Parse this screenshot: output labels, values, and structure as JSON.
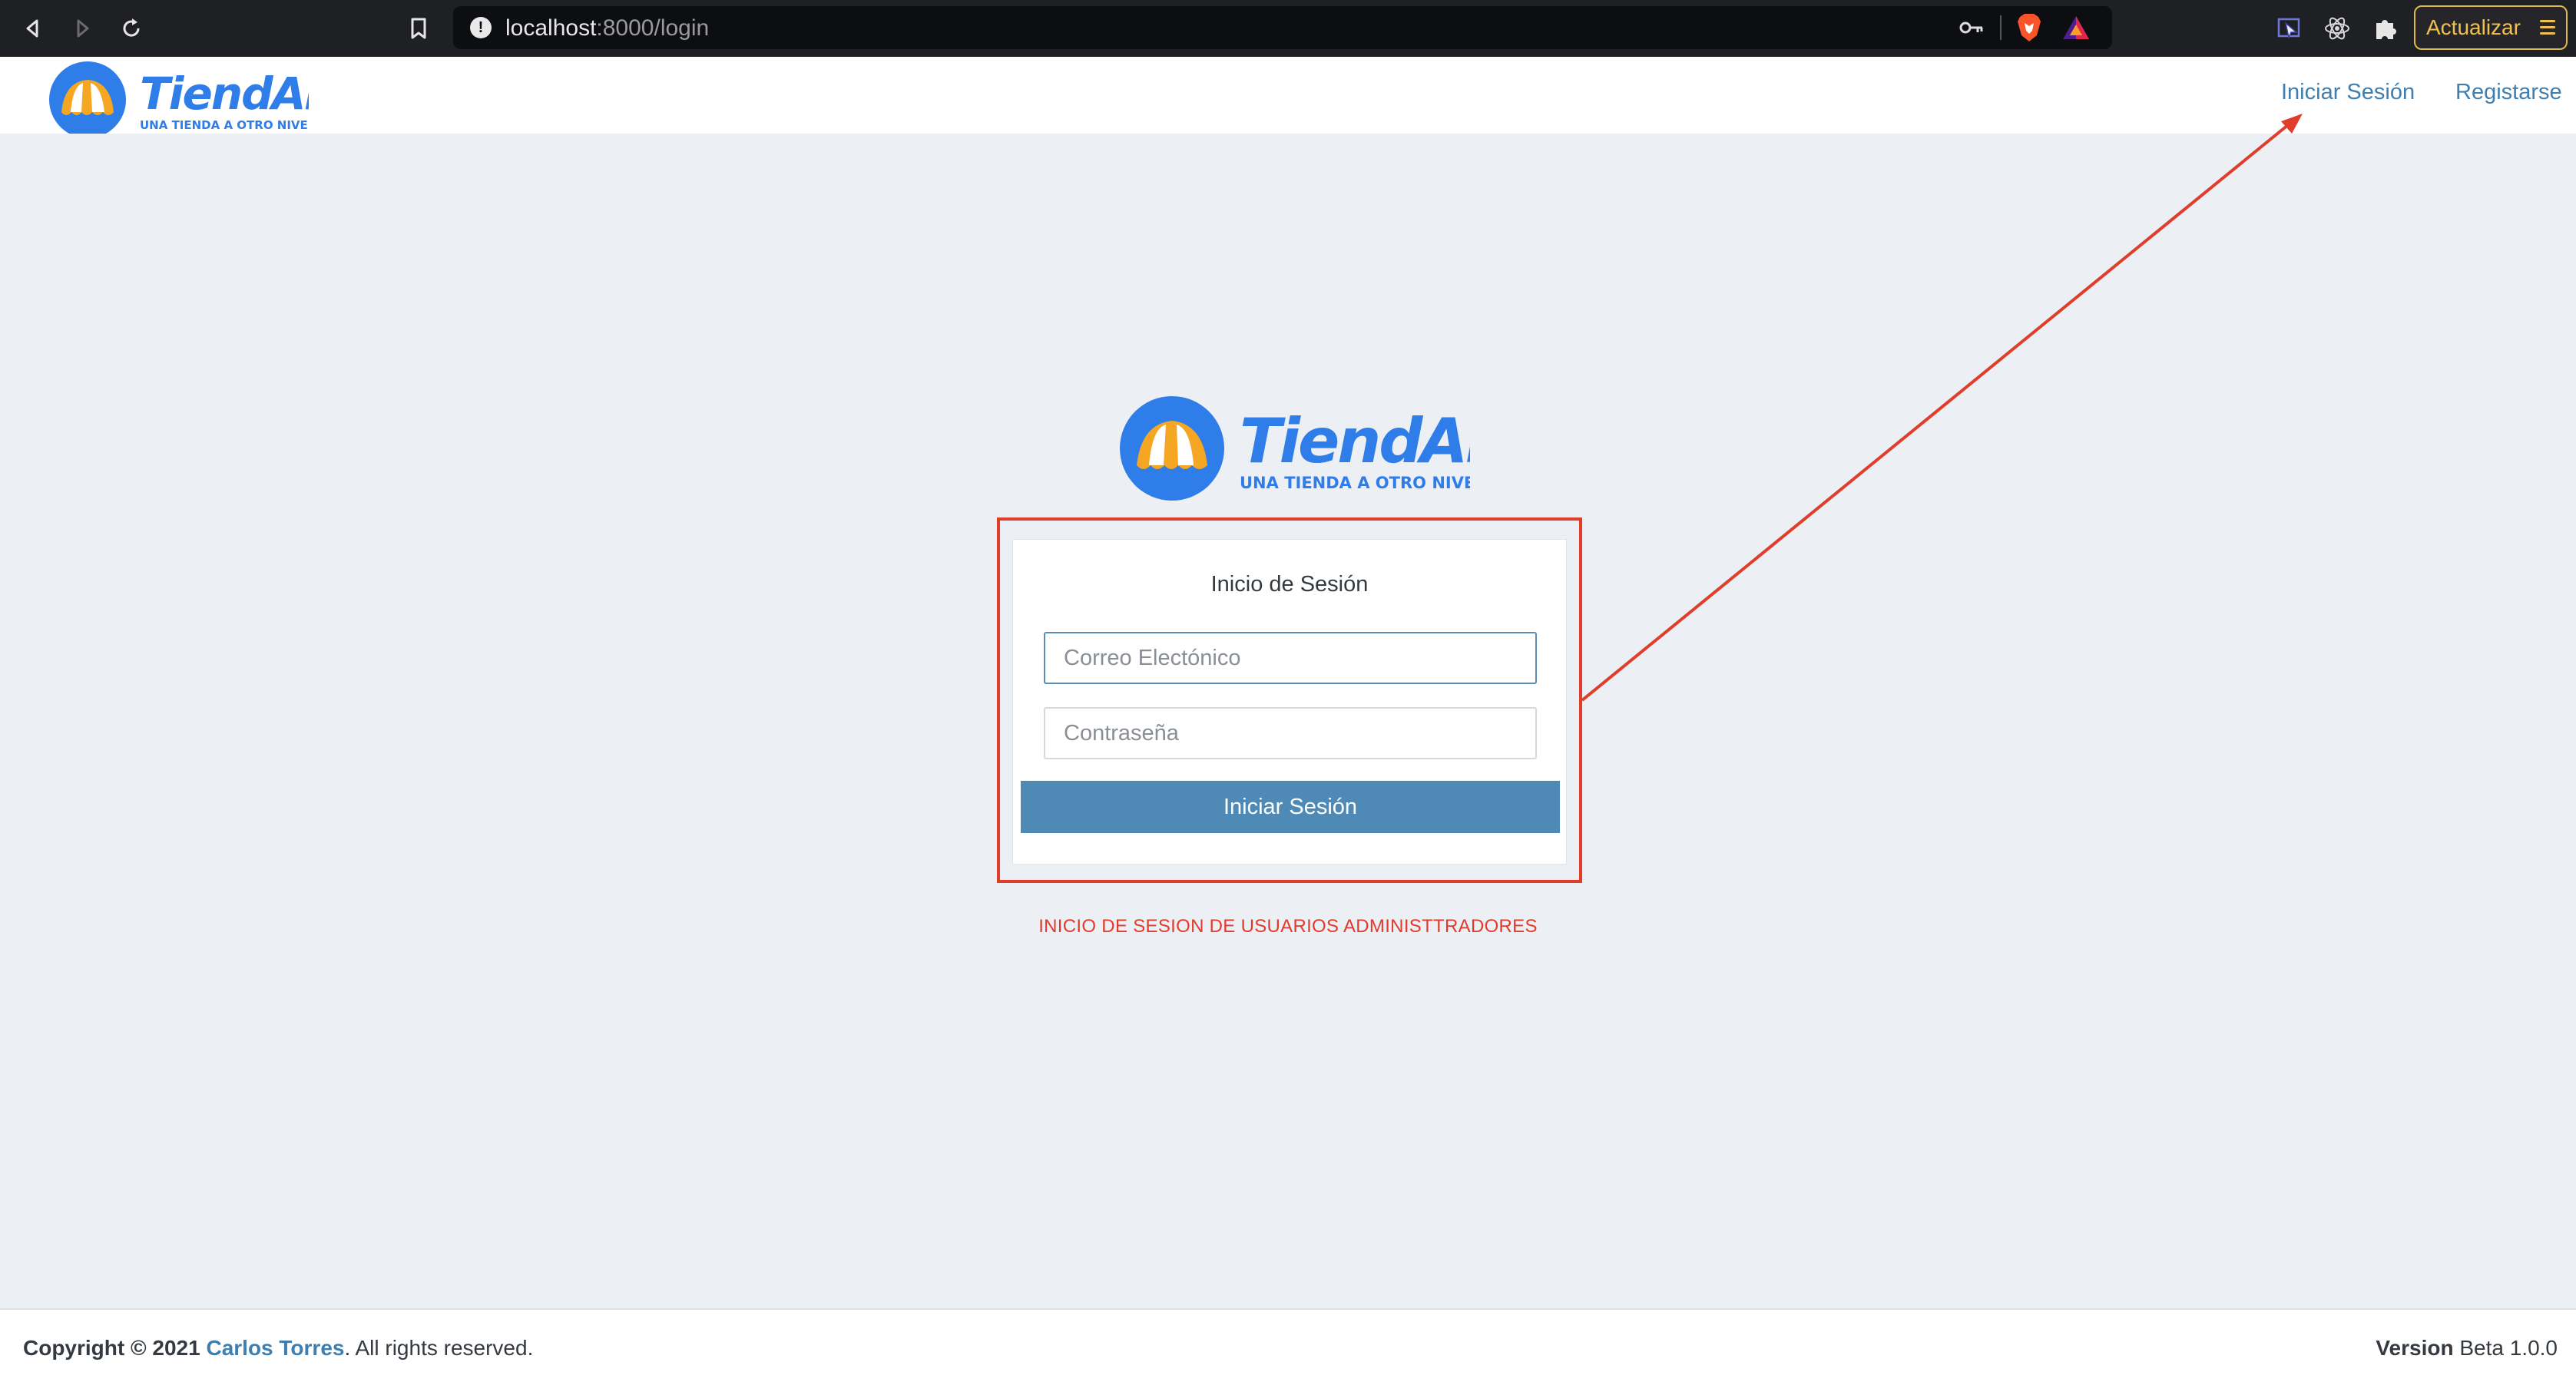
{
  "browser": {
    "url_host": "localhost",
    "url_rest": ":8000/login",
    "update_label": "Actualizar"
  },
  "header": {
    "logo_text": "TiendAPP",
    "logo_tagline": "UNA TIENDA A OTRO NIVEL",
    "nav": {
      "login": "Iniciar Sesión",
      "register": "Registarse"
    }
  },
  "main": {
    "logo_text": "TiendAPP",
    "logo_tagline": "UNA TIENDA A OTRO NIVEL",
    "form": {
      "title": "Inicio de Sesión",
      "email_placeholder": "Correo Electónico",
      "password_placeholder": "Contraseña",
      "submit_label": "Iniciar Sesión"
    },
    "admin_note": "INICIO DE SESION DE USUARIOS ADMINISTTRADORES"
  },
  "footer": {
    "copyright_prefix": "Copyright © 2021",
    "author": "Carlos Torres",
    "rights": ". All rights reserved.",
    "version_label": "Version",
    "version_value": "Beta 1.0.0"
  },
  "colors": {
    "accent": "#3f7fb0",
    "button": "#4f8ab7",
    "annotation": "#e03d2b",
    "logo_blue": "#2f7de8",
    "logo_orange": "#f5a623"
  },
  "icons": [
    "back-icon",
    "forward-icon",
    "reload-icon",
    "bookmark-icon",
    "info-icon",
    "key-icon",
    "brave-shield-icon",
    "brave-rewards-icon",
    "cursor-extension-icon",
    "react-devtools-icon",
    "puzzle-icon",
    "menu-icon"
  ]
}
